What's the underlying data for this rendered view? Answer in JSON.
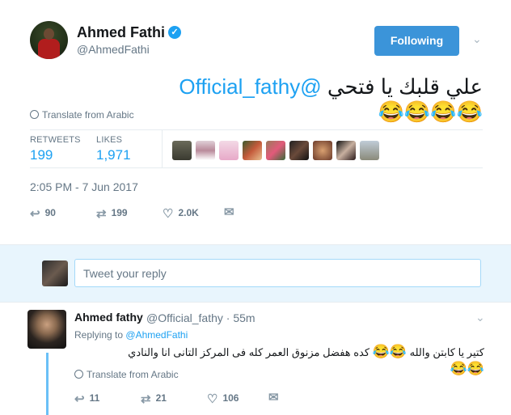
{
  "author": {
    "name": "Ahmed Fathi",
    "handle": "@AhmedFathi",
    "verified": true
  },
  "follow_button": {
    "label": "Following"
  },
  "tweet": {
    "text_arabic": "علي قلبك يا فتحي",
    "mention": "@Official_fathy",
    "emojis": "😂😂😂😂",
    "translate_label": "Translate from Arabic",
    "retweets_label": "RETWEETS",
    "retweets_count": "199",
    "likes_label": "LIKES",
    "likes_count": "1,971",
    "timestamp": "2:05 PM - 7 Jun 2017",
    "actions": {
      "reply_count": "90",
      "retweet_count": "199",
      "like_count": "2.0K"
    }
  },
  "reply_box": {
    "placeholder": "Tweet your reply"
  },
  "reply": {
    "name": "Ahmed fathy",
    "handle": "@Official_fathy",
    "time": "· 55m",
    "replying_to_label": "Replying to",
    "replying_to_handle": "@AhmedFathi",
    "text_line1_a": "كتير يا كابتن والله",
    "text_line1_emoji_a": "😂😂",
    "text_line1_b": "كده هفضل مزنوق العمر كله فى المركز التانى انا والنادي",
    "text_line2_emoji": "😂😂",
    "translate_label": "Translate from Arabic",
    "actions": {
      "reply_count": "11",
      "retweet_count": "21",
      "like_count": "106"
    }
  },
  "colors": {
    "accent": "#1da1f2",
    "follow_bg": "#3b94d9",
    "reply_bg": "#e8f5fd"
  }
}
